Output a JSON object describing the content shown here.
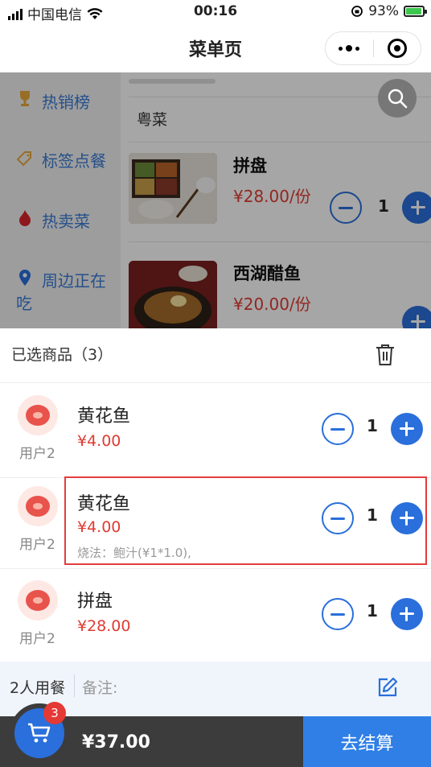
{
  "status_bar": {
    "carrier": "中国电信",
    "time": "00:16",
    "battery": "93%"
  },
  "nav": {
    "title": "菜单页"
  },
  "sidebar": {
    "items": [
      {
        "label": "热销榜",
        "icon": "trophy-icon"
      },
      {
        "label": "标签点餐",
        "icon": "tag-icon"
      },
      {
        "label": "热卖菜",
        "icon": "fire-icon"
      },
      {
        "label": "周边正在吃",
        "icon": "location-pin-icon"
      }
    ]
  },
  "menu": {
    "section_title": "粤菜",
    "dishes": [
      {
        "name": "拼盘",
        "price": "¥28.00/份",
        "qty": "1"
      },
      {
        "name": "西湖醋鱼",
        "price": "¥20.00/份"
      }
    ]
  },
  "cart": {
    "title": "已选商品（3）",
    "items": [
      {
        "user": "用户2",
        "name": "黄花鱼",
        "price": "¥4.00",
        "option": "",
        "qty": "1"
      },
      {
        "user": "用户2",
        "name": "黄花鱼",
        "price": "¥4.00",
        "option": "烧法：鲍汁(¥1*1.0),",
        "qty": "1"
      },
      {
        "user": "用户2",
        "name": "拼盘",
        "price": "¥28.00",
        "option": "",
        "qty": "1"
      }
    ]
  },
  "remark": {
    "people": "2人用餐",
    "label": "备注:"
  },
  "bottom": {
    "badge": "3",
    "total": "¥37.00",
    "checkout": "去结算"
  },
  "colors": {
    "accent": "#2a6fdb",
    "price": "#e03b32",
    "highlight": "#e33c3c"
  }
}
